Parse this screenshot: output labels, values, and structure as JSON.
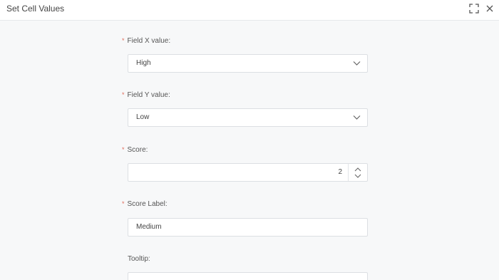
{
  "window": {
    "title": "Set Cell Values"
  },
  "header": {
    "expand_icon": "expand-icon",
    "close_icon": "close-icon"
  },
  "form": {
    "required_marker": "*",
    "field_x": {
      "label": "Field X value:",
      "value": "High"
    },
    "field_y": {
      "label": "Field Y value:",
      "value": "Low"
    },
    "score": {
      "label": "Score:",
      "value": "2"
    },
    "score_label": {
      "label": "Score Label:",
      "value": "Medium"
    },
    "tooltip": {
      "label": "Tooltip:",
      "value": ""
    }
  },
  "colors": {
    "required": "#e06b5a",
    "background": "#f7f8f9",
    "border": "#dcdfe3"
  }
}
